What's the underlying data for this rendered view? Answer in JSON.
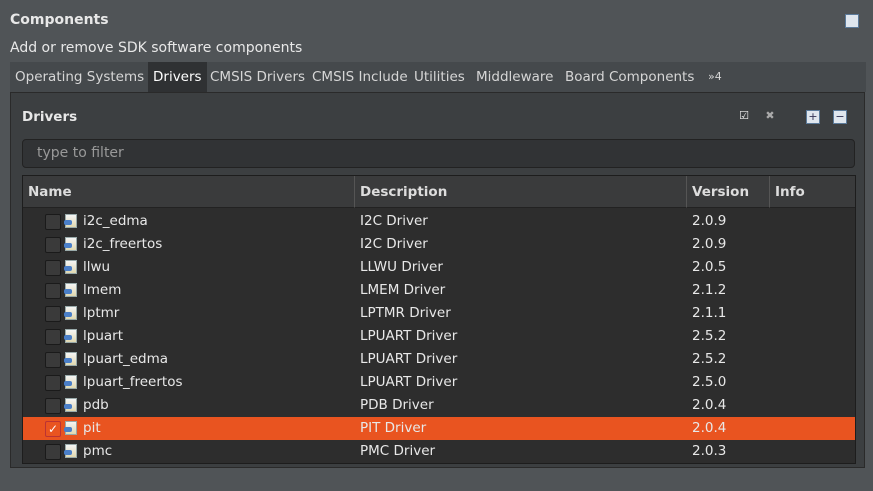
{
  "title": "Components",
  "subtitle": "Add or remove SDK software components",
  "tabs": [
    {
      "label": "Operating Systems"
    },
    {
      "label": "Drivers",
      "active": true
    },
    {
      "label": "CMSIS Drivers"
    },
    {
      "label": "CMSIS Include"
    },
    {
      "label": "Utilities"
    },
    {
      "label": "Middleware"
    },
    {
      "label": "Board Components"
    },
    {
      "label": "»4"
    }
  ],
  "panel": {
    "title": "Drivers",
    "filter_placeholder": "type to filter"
  },
  "columns": [
    "Name",
    "Description",
    "Version",
    "Info"
  ],
  "rows": [
    {
      "name": "i2c_edma",
      "desc": "I2C Driver",
      "ver": "2.0.9",
      "checked": false
    },
    {
      "name": "i2c_freertos",
      "desc": "I2C Driver",
      "ver": "2.0.9",
      "checked": false
    },
    {
      "name": "llwu",
      "desc": "LLWU Driver",
      "ver": "2.0.5",
      "checked": false
    },
    {
      "name": "lmem",
      "desc": "LMEM Driver",
      "ver": "2.1.2",
      "checked": false
    },
    {
      "name": "lptmr",
      "desc": "LPTMR Driver",
      "ver": "2.1.1",
      "checked": false
    },
    {
      "name": "lpuart",
      "desc": "LPUART Driver",
      "ver": "2.5.2",
      "checked": false
    },
    {
      "name": "lpuart_edma",
      "desc": "LPUART Driver",
      "ver": "2.5.2",
      "checked": false
    },
    {
      "name": "lpuart_freertos",
      "desc": "LPUART Driver",
      "ver": "2.5.0",
      "checked": false
    },
    {
      "name": "pdb",
      "desc": "PDB Driver",
      "ver": "2.0.4",
      "checked": false
    },
    {
      "name": "pit",
      "desc": "PIT Driver",
      "ver": "2.0.4",
      "checked": true,
      "selected": true
    },
    {
      "name": "pmc",
      "desc": "PMC Driver",
      "ver": "2.0.3",
      "checked": false
    }
  ],
  "colors": {
    "selection": "#e95420",
    "background": "#505457"
  }
}
